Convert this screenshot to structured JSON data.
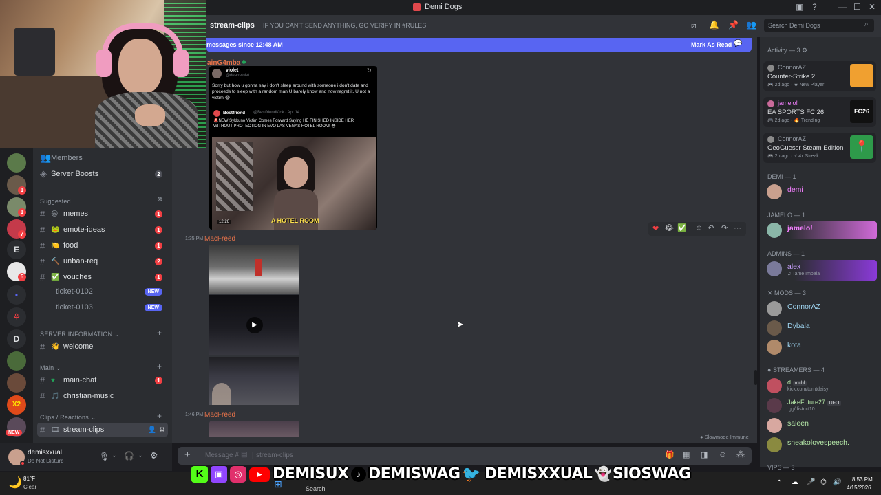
{
  "window": {
    "title": "Demi Dogs"
  },
  "header": {
    "channel": "stream-clips",
    "topic": "IF YOU CAN'T SEND ANYTHING, GO VERIFY IN #RULES",
    "search_placeholder": "Search Demi Dogs"
  },
  "new_messages": {
    "text": "messages since 12:48 AM",
    "mark_read": "Mark As Read"
  },
  "channels": {
    "members": "Members",
    "server_boosts": "Server Boosts",
    "server_boosts_count": "2",
    "suggested_label": "Suggested",
    "suggested": [
      {
        "name": "memes",
        "badge": "1"
      },
      {
        "name": "emote-ideas",
        "badge": "1"
      },
      {
        "name": "food",
        "badge": "1"
      },
      {
        "name": "unban-req",
        "badge": "2"
      },
      {
        "name": "vouches",
        "badge": "1"
      }
    ],
    "tickets": [
      {
        "name": "ticket-0102",
        "badge": "NEW"
      },
      {
        "name": "ticket-0103",
        "badge": "NEW"
      }
    ],
    "server_info_label": "SERVER INFORMATION",
    "welcome": "welcome",
    "main_label": "Main",
    "main_chat": "main-chat",
    "main_chat_badge": "1",
    "christian_music": "christian-music",
    "clips_label": "Clips / Reactions",
    "stream_clips": "stream-clips"
  },
  "servers": {
    "letter_e": "E",
    "letter_d": "D",
    "new_label": "NEW",
    "badges": [
      "1",
      "1",
      "7",
      "5"
    ]
  },
  "user": {
    "name": "demisxxual",
    "status": "Do Not Disturb"
  },
  "messages": [
    {
      "author": "ainG4mba",
      "embed": {
        "handle": "violet",
        "subhandle": "@dearrviolet",
        "text": "Sorry but how u gonna say i don't sleep around with someone i don't date and proceeds to sleep with a random man U barely know and now regret it. U not a victim 😭",
        "quote_author": "Bestfriend",
        "quote_handle": "@BestfriendKick · Apr 14",
        "quote_text": "🚨NEW Sykkuno Victim Comes Forward Saying HE FINISHED INSIDE HER WITHOUT PROTECTION IN EVO LAS VEGAS HOTEL ROOM! 😳",
        "video_caption": "A HOTEL ROOM",
        "video_time": "12:26"
      }
    },
    {
      "time": "1:35 PM",
      "author": "MacFreed"
    },
    {
      "time": "1:46 PM",
      "author": "MacFreed"
    }
  ],
  "composer": {
    "placeholder": "Message #",
    "channel": "stream-clips",
    "slowmode": "Slowmode Immune"
  },
  "members": {
    "activity_label": "Activity — 3",
    "activities": [
      {
        "user": "ConnorAZ",
        "game": "Counter-Strike 2",
        "time": "2d ago",
        "tag": "New Player"
      },
      {
        "user": "jamelo!",
        "game": "EA SPORTS FC 26",
        "time": "2d ago",
        "tag": "Trending"
      },
      {
        "user": "ConnorAZ",
        "game": "GeoGuessr Steam Edition",
        "time": "2h ago",
        "tag": "4x Streak"
      }
    ],
    "demi_label": "DEMI — 1",
    "demi": "demi",
    "jamelo_label": "JAMELO — 1",
    "jamelo": "jamelo!",
    "admins_label": "ADMINS — 1",
    "alex": "alex",
    "alex_sub": "Tame Impala",
    "mods_label": "MODS — 3",
    "mods": [
      "ConnorAZ",
      "Dybala",
      "kota"
    ],
    "streamers_label": "STREAMERS — 4",
    "streamers": [
      {
        "name": "d",
        "tag": "mchl",
        "sub": "kick.com/turntdaisy"
      },
      {
        "name": "JakeFuture27",
        "tag": "UFO",
        "sub": ".gg/district10"
      },
      {
        "name": "saleen",
        "tag": "",
        "sub": ""
      },
      {
        "name": "sneakolovespeech.",
        "tag": "",
        "sub": ""
      }
    ],
    "vips_label": "VIPS — 3"
  },
  "overlay": {
    "demisux": "DEMISUX",
    "demiswag": "DEMISWAG",
    "demisxxual": "DEMISXXUAL",
    "sioswag": "SIOSWAG"
  },
  "taskbar": {
    "temp": "81°F",
    "weather": "Clear",
    "search": "Search",
    "time": "8:53 PM",
    "date": "4/15/2026"
  },
  "colors": {
    "accent": "#5865f2",
    "mention_red": "#f23f43",
    "macfreed": "#e8734a",
    "green": "#23a55a",
    "jamelo_pink": "#f47fff",
    "alex_purple": "#b36bff"
  }
}
